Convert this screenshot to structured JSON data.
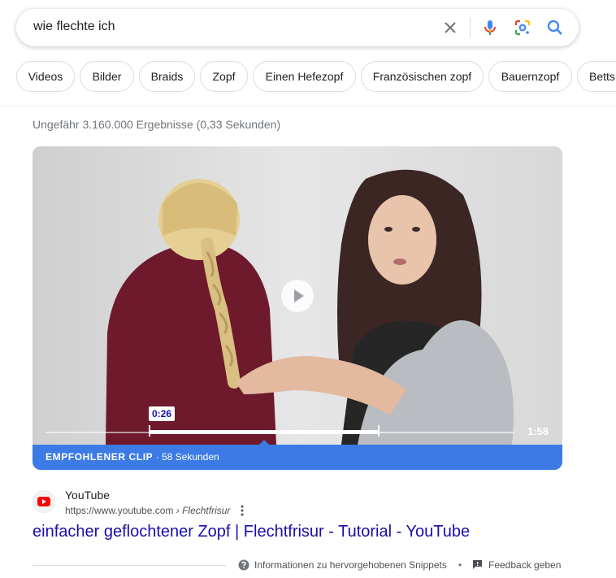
{
  "search": {
    "query": "wie flechte ich",
    "clear_icon": "close-icon",
    "voice_icon": "microphone-icon",
    "lens_icon": "camera-lens-icon",
    "search_icon": "search-icon"
  },
  "chips": [
    "Videos",
    "Bilder",
    "Braids",
    "Zopf",
    "Einen Hefezopf",
    "Französischen zopf",
    "Bauernzopf",
    "Betts"
  ],
  "stats": "Ungefähr 3.160.000 Ergebnisse (0,33 Sekunden)",
  "video": {
    "clip_start": "0:26",
    "duration": "1:58",
    "clip_label": "EMPFOHLENER CLIP",
    "clip_length": "· 58 Sekunden",
    "play_icon": "play-icon",
    "colors": {
      "clip_bar": "#3c7be6",
      "link": "#1a0dab"
    }
  },
  "result": {
    "site_name": "YouTube",
    "url": "https://www.youtube.com",
    "breadcrumb": "› Flechtfrisur",
    "title": "einfacher geflochtener Zopf | Flechtfrisur - Tutorial - YouTube",
    "favicon_icon": "youtube-icon",
    "more_icon": "more-vert-icon"
  },
  "footer": {
    "snippets_info": "Informationen zu hervorgehobenen Snippets",
    "separator": "•",
    "feedback": "Feedback geben",
    "help_icon": "help-icon",
    "feedback_icon": "feedback-icon"
  }
}
